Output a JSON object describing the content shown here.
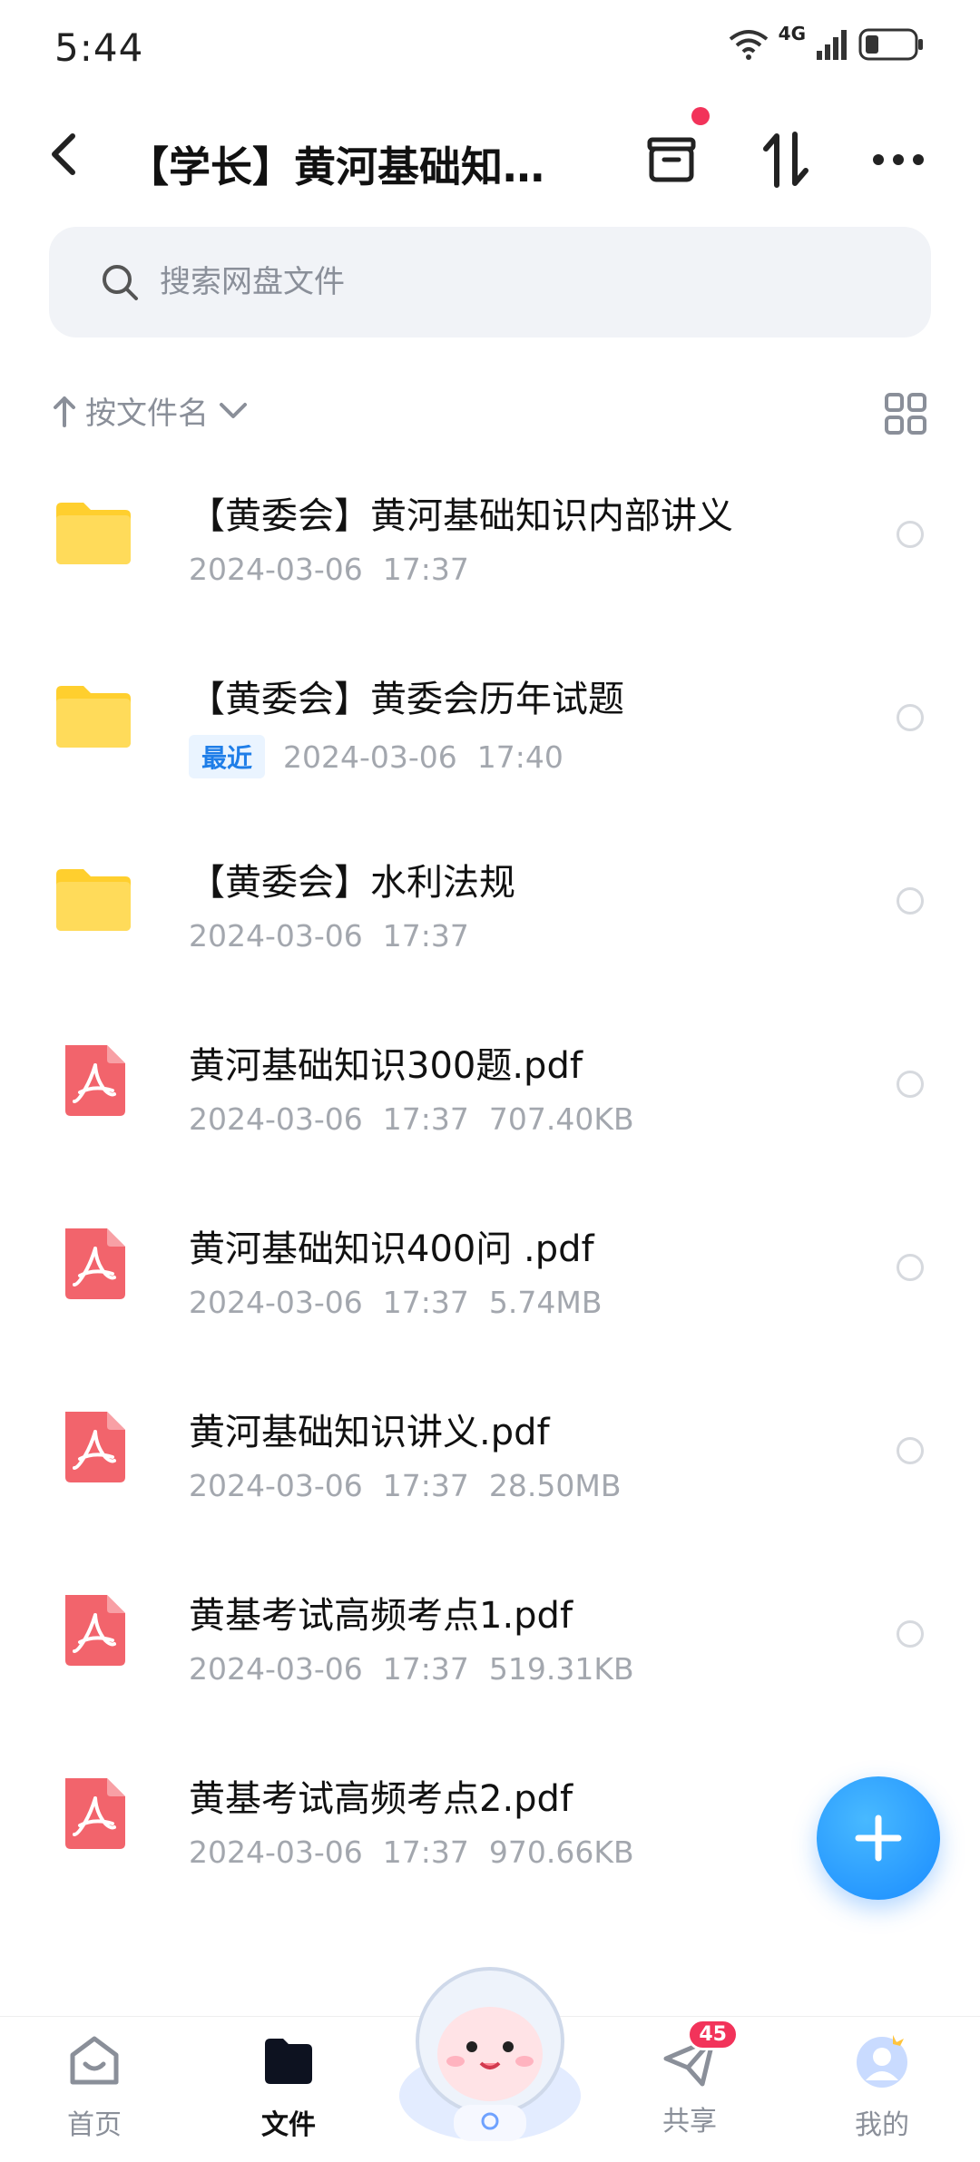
{
  "status_bar": {
    "time": "5:44",
    "network": "4G"
  },
  "header": {
    "title": "【学长】黄河基础知识..."
  },
  "search": {
    "placeholder": "搜索网盘文件"
  },
  "sort": {
    "label": "按文件名"
  },
  "files": [
    {
      "name": "【黄委会】黄河基础知识内部讲义",
      "type": "folder",
      "date": "2024-03-06",
      "time": "17:37",
      "size": "",
      "recent": ""
    },
    {
      "name": "【黄委会】黄委会历年试题",
      "type": "folder",
      "date": "2024-03-06",
      "time": "17:40",
      "size": "",
      "recent": "最近"
    },
    {
      "name": "【黄委会】水利法规",
      "type": "folder",
      "date": "2024-03-06",
      "time": "17:37",
      "size": "",
      "recent": ""
    },
    {
      "name": "黄河基础知识300题.pdf",
      "type": "pdf",
      "date": "2024-03-06",
      "time": "17:37",
      "size": "707.40KB",
      "recent": ""
    },
    {
      "name": "黄河基础知识400问 .pdf",
      "type": "pdf",
      "date": "2024-03-06",
      "time": "17:37",
      "size": "5.74MB",
      "recent": ""
    },
    {
      "name": "黄河基础知识讲义.pdf",
      "type": "pdf",
      "date": "2024-03-06",
      "time": "17:37",
      "size": "28.50MB",
      "recent": ""
    },
    {
      "name": "黄基考试高频考点1.pdf",
      "type": "pdf",
      "date": "2024-03-06",
      "time": "17:37",
      "size": "519.31KB",
      "recent": ""
    },
    {
      "name": "黄基考试高频考点2.pdf",
      "type": "pdf",
      "date": "2024-03-06",
      "time": "17:37",
      "size": "970.66KB",
      "recent": ""
    }
  ],
  "bottom_nav": [
    {
      "label": "首页",
      "icon": "home-icon"
    },
    {
      "label": "文件",
      "icon": "files-icon",
      "active": true
    },
    {
      "label": "共享",
      "icon": "share-icon",
      "badge": "45"
    },
    {
      "label": "我的",
      "icon": "profile-icon"
    }
  ],
  "colors": {
    "accent": "#1a8cff",
    "badge": "#f2335a",
    "folder": "#ffd23f",
    "pdf": "#f2646c"
  }
}
